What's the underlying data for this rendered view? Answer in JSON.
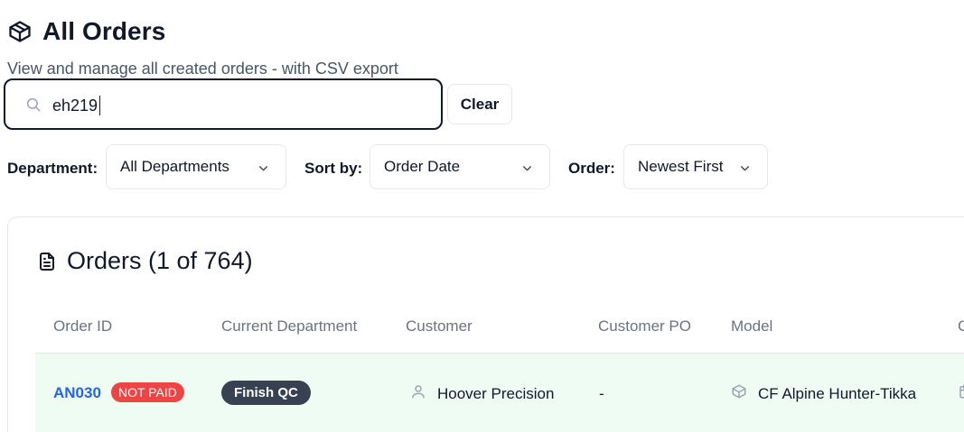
{
  "header": {
    "title": "All Orders",
    "subtitle": "View and manage all created orders - with CSV export"
  },
  "search": {
    "value": "eh219",
    "clear_label": "Clear"
  },
  "filters": {
    "department_label": "Department:",
    "department_value": "All Departments",
    "sort_label": "Sort by:",
    "sort_value": "Order Date",
    "order_label": "Order:",
    "order_value": "Newest First"
  },
  "orders_card": {
    "title": "Orders (1 of 764)",
    "columns": [
      "Order ID",
      "Current Department",
      "Customer",
      "Customer PO",
      "Model",
      "C"
    ],
    "rows": [
      {
        "order_id": "AN030",
        "payment_status": "NOT PAID",
        "department": "Finish QC",
        "customer": "Hoover Precision",
        "customer_po": "-",
        "model": "CF Alpine Hunter-Tikka"
      }
    ]
  },
  "colors": {
    "link": "#2563eb",
    "not_paid": "#ef4444",
    "dept_badge": "#374151",
    "row_highlight": "#eefcf3"
  },
  "icons": {
    "title": "package-icon",
    "search": "search-icon",
    "select": "chevron-down-icon",
    "card": "file-text-icon",
    "customer": "user-icon",
    "model": "package-icon",
    "next_cell": "calendar-icon"
  }
}
